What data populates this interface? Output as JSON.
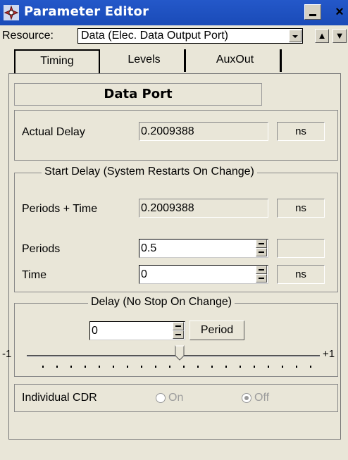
{
  "window": {
    "title": "Parameter Editor",
    "close_glyph": "×"
  },
  "resource": {
    "label": "Resource:",
    "value": "Data (Elec. Data Output Port)"
  },
  "tabs": [
    {
      "label": "Timing",
      "active": true
    },
    {
      "label": "Levels",
      "active": false
    },
    {
      "label": "AuxOut",
      "active": false
    }
  ],
  "header": {
    "title": "Data Port"
  },
  "actual_delay": {
    "label": "Actual Delay",
    "value": "0.2009388",
    "unit": "ns"
  },
  "start_delay": {
    "title": "Start Delay (System Restarts On Change)",
    "periods_time": {
      "label": "Periods + Time",
      "value": "0.2009388",
      "unit": "ns"
    },
    "periods": {
      "label": "Periods",
      "value": "0.5",
      "unit": ""
    },
    "time": {
      "label": "Time",
      "value": "0",
      "unit": "ns"
    }
  },
  "delay": {
    "title": "Delay (No Stop On Change)",
    "value": "0",
    "button_label": "Period",
    "slider_min_label": "-1",
    "slider_max_label": "+1"
  },
  "individual_cdr": {
    "label": "Individual CDR",
    "on_label": "On",
    "off_label": "Off",
    "selected": "Off"
  },
  "arrows": {
    "up": "▲",
    "down": "▼"
  }
}
